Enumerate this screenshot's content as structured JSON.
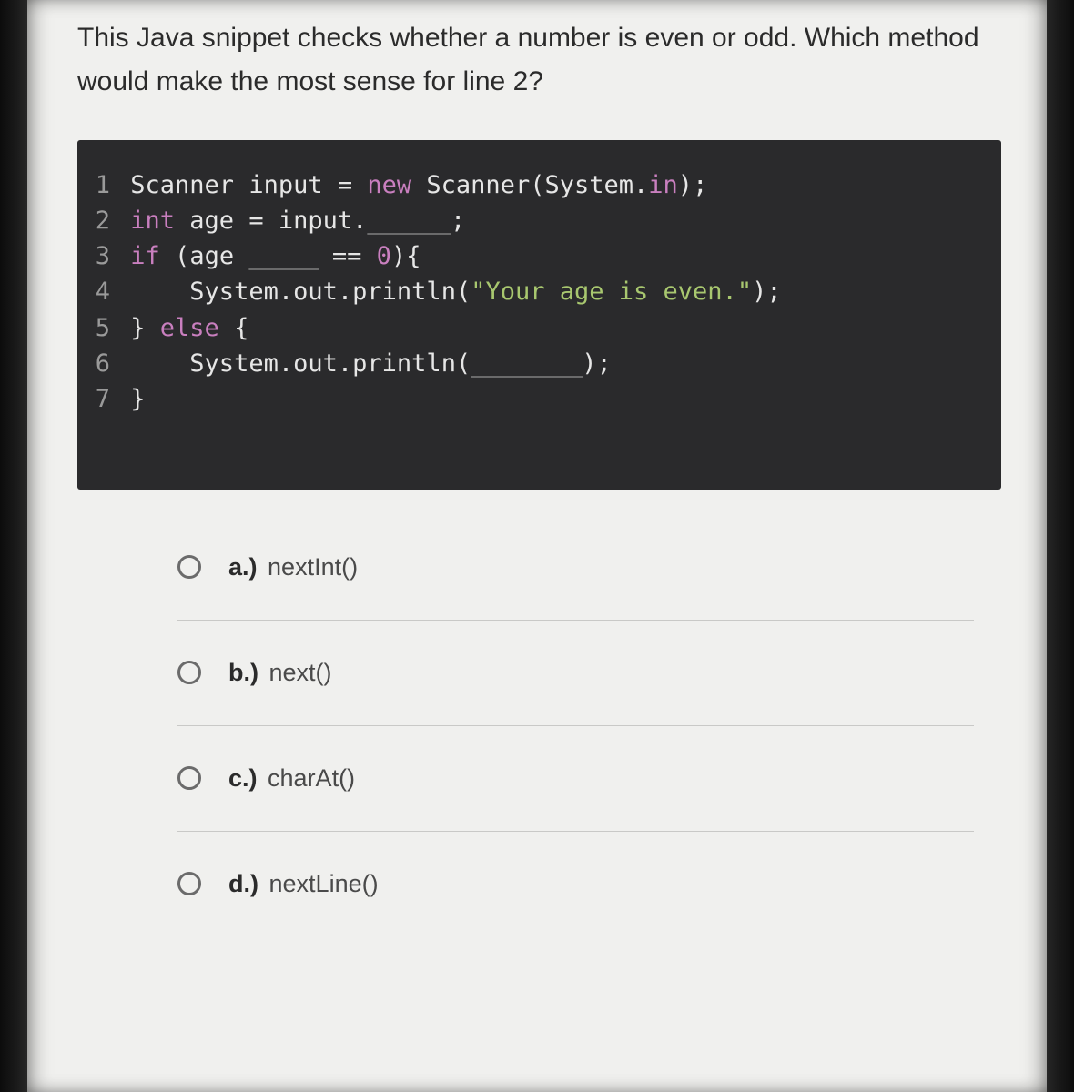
{
  "question": "This Java snippet checks whether a number is even or odd. Which method would make the most sense for line 2?",
  "code": {
    "lines": [
      {
        "n": "1",
        "segs": [
          "Scanner ",
          "input ",
          "= ",
          "new ",
          "Scanner",
          "(",
          "System",
          ".",
          "in",
          ")",
          ";"
        ]
      },
      {
        "n": "2",
        "segs": [
          "int ",
          "age ",
          "= ",
          "input",
          ".",
          "______",
          ";"
        ]
      },
      {
        "n": "3",
        "segs": [
          "if ",
          "(",
          "age ",
          "_____ ",
          "== ",
          "0",
          ")",
          "{"
        ]
      },
      {
        "n": "4",
        "segs": [
          "    ",
          "System",
          ".",
          "out",
          ".",
          "println",
          "(",
          "\"Your age is even.\"",
          ")",
          ";"
        ]
      },
      {
        "n": "5",
        "segs": [
          "} ",
          "else ",
          "{"
        ]
      },
      {
        "n": "6",
        "segs": [
          "    ",
          "System",
          ".",
          "out",
          ".",
          "println",
          "(",
          "________",
          ")",
          ";"
        ]
      },
      {
        "n": "7",
        "segs": [
          "}"
        ]
      }
    ]
  },
  "options": [
    {
      "label": "a.)",
      "text": "nextInt()"
    },
    {
      "label": "b.)",
      "text": "next()"
    },
    {
      "label": "c.)",
      "text": "charAt()"
    },
    {
      "label": "d.)",
      "text": "nextLine()"
    }
  ]
}
